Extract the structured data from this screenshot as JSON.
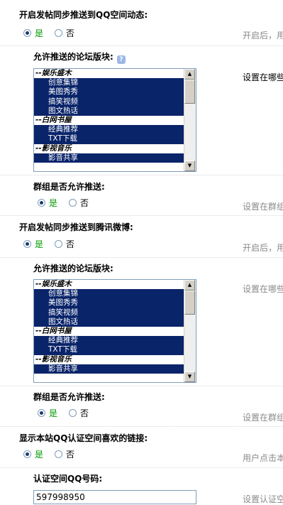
{
  "section1": {
    "title": "开启发帖同步推送到QQ空间动态:",
    "yes": "是",
    "no": "否",
    "hint": "开启后，用"
  },
  "forums1": {
    "title": "允许推送的论坛版块:",
    "help_icon": "question-icon",
    "hint": "设置在哪些",
    "options": [
      {
        "label": "--娱乐盛木",
        "type": "group"
      },
      {
        "label": "创意集锦",
        "type": "item"
      },
      {
        "label": "美图秀秀",
        "type": "item"
      },
      {
        "label": "搞笑视频",
        "type": "item"
      },
      {
        "label": "图文热话",
        "type": "item"
      },
      {
        "label": "--白网书屋",
        "type": "group"
      },
      {
        "label": "经典推荐",
        "type": "item"
      },
      {
        "label": "TXT下载",
        "type": "item"
      },
      {
        "label": "--影视音乐",
        "type": "group"
      },
      {
        "label": "影音共享",
        "type": "item"
      }
    ]
  },
  "group1": {
    "title": "群组是否允许推送:",
    "yes": "是",
    "no": "否",
    "hint": "设置在群组"
  },
  "section2": {
    "title": "开启发帖同步推送到腾讯微博:",
    "yes": "是",
    "no": "否",
    "hint": "开启后，用"
  },
  "forums2": {
    "title": "允许推送的论坛版块:",
    "hint": "设置在哪些",
    "options": [
      {
        "label": "--娱乐盛木",
        "type": "group"
      },
      {
        "label": "创意集锦",
        "type": "item"
      },
      {
        "label": "美图秀秀",
        "type": "item"
      },
      {
        "label": "搞笑视频",
        "type": "item"
      },
      {
        "label": "图文热话",
        "type": "item"
      },
      {
        "label": "--白网书屋",
        "type": "group"
      },
      {
        "label": "经典推荐",
        "type": "item"
      },
      {
        "label": "TXT下载",
        "type": "item"
      },
      {
        "label": "--影视音乐",
        "type": "group"
      },
      {
        "label": "影音共享",
        "type": "item"
      }
    ]
  },
  "group2": {
    "title": "群组是否允许推送:",
    "yes": "是",
    "no": "否",
    "hint": "设置在群组"
  },
  "section3": {
    "title": "显示本站QQ认证空间喜欢的链接:",
    "yes": "是",
    "no": "否",
    "hint": "用户点击本"
  },
  "qq_number": {
    "title": "认证空间QQ号码:",
    "value": "597998950",
    "hint": "设置认证空"
  },
  "colors": {
    "selection": "#0a246a",
    "yes_text": "#009900",
    "hint_text": "#8a8a8a"
  }
}
